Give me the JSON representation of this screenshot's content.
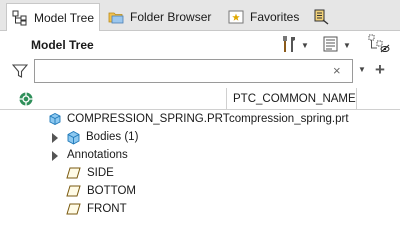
{
  "tabs": [
    {
      "label": "Model Tree",
      "active": true
    },
    {
      "label": "Folder Browser",
      "active": false
    },
    {
      "label": "Favorites",
      "active": false
    }
  ],
  "panel": {
    "title": "Model Tree"
  },
  "filter": {
    "search_value": "",
    "placeholder": "",
    "clear_glyph": "×",
    "add_glyph": "+"
  },
  "columns": {
    "name_header": "PTC_COMMON_NAME"
  },
  "tree": {
    "root": {
      "label": "COMPRESSION_SPRING.PRT",
      "common_name": "compression_spring.prt"
    },
    "bodies": {
      "label": "Bodies (1)"
    },
    "annotations": {
      "label": "Annotations"
    },
    "planes": [
      {
        "label": "SIDE"
      },
      {
        "label": "BOTTOM"
      },
      {
        "label": "FRONT"
      }
    ]
  },
  "colors": {
    "accent": "#1e88c8",
    "tab_bg": "#e6e6e6",
    "border": "#c8c8c8"
  }
}
